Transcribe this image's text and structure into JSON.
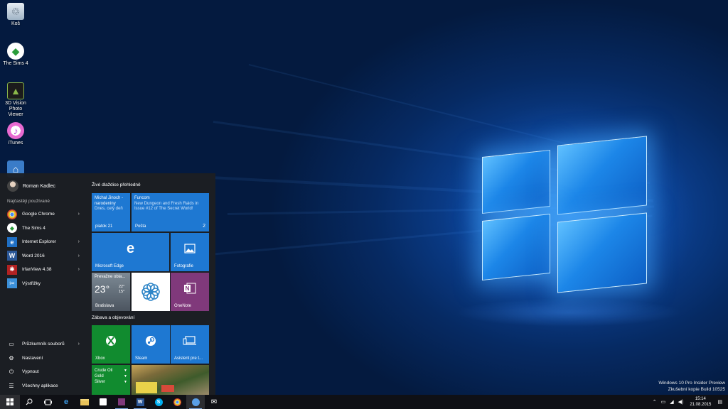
{
  "desktop": {
    "icons": [
      {
        "label": "Koš",
        "icon": "recycle-bin-icon"
      },
      {
        "label": "The Sims 4",
        "icon": "sims-icon"
      },
      {
        "label": "3D Vision Photo Viewer",
        "icon": "3d-vision-icon"
      },
      {
        "label": "iTunes",
        "icon": "itunes-icon"
      },
      {
        "label": "",
        "icon": "app-icon"
      }
    ]
  },
  "start_menu": {
    "user_name": "Roman Kadlec",
    "most_used_label": "Najčastěji používané",
    "apps": [
      {
        "label": "Google Chrome",
        "icon": "chrome-icon",
        "has_submenu": true
      },
      {
        "label": "The Sims 4",
        "icon": "sims-icon",
        "has_submenu": false
      },
      {
        "label": "Internet Explorer",
        "icon": "ie-icon",
        "has_submenu": true
      },
      {
        "label": "Word 2016",
        "icon": "word-icon",
        "has_submenu": true
      },
      {
        "label": "IrfanView 4.38",
        "icon": "irfanview-icon",
        "has_submenu": true
      },
      {
        "label": "Výstřižky",
        "icon": "snipping-icon",
        "has_submenu": false
      }
    ],
    "bottom": {
      "explorer": "Průzkumník souborů",
      "settings": "Nastavení",
      "power": "Vypnout",
      "all_apps": "Všechny aplikace"
    },
    "group1_title": "Živé dlaždice přehledně",
    "group2_title": "Zábava a objevování",
    "tiles": {
      "calendar": {
        "line1": "Michal Jinoch -",
        "line2": "narodeniny",
        "line3": "Dnes, celý deň",
        "footer": "piatok 21"
      },
      "mail": {
        "line1": "Funcom",
        "line2": "New Dungeon and Fresh Raids in",
        "line3": "Issue #12 of The Secret World!",
        "footer": "Pošta",
        "count": "2"
      },
      "edge": {
        "name": "Microsoft Edge"
      },
      "photos": {
        "name": "Fotografie"
      },
      "weather": {
        "title": "Prevažne obla...",
        "temp": "23°",
        "high": "22°",
        "low": "15°",
        "city": "Bratislava"
      },
      "onenote": {
        "name": "OneNote"
      },
      "xbox": {
        "name": "Xbox"
      },
      "steam": {
        "name": "Steam"
      },
      "connect": {
        "name": "Asistent pre t..."
      },
      "money": {
        "items": [
          "Crude Oil",
          "Gold",
          "Silver"
        ]
      }
    }
  },
  "taskbar": {
    "time": "15:14",
    "date": "21.08.2015"
  },
  "watermark": {
    "line1": "Windows 10 Pro Insider Preview",
    "line2": "Zkušební kopie Build 10525"
  },
  "colors": {
    "tile_blue": "#1e78d2",
    "tile_green": "#118b2f",
    "tile_purple": "#80397b",
    "tile_gray": "#5a5a5a"
  }
}
